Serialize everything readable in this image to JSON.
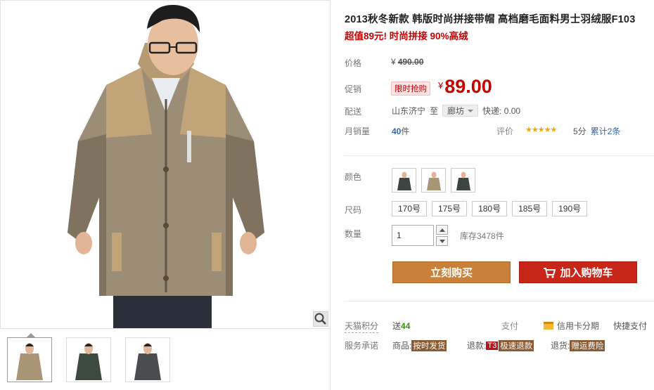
{
  "product": {
    "title": "2013秋冬新款 韩版时尚拼接带帽 高档磨毛面料男士羽绒服F103",
    "subtitle": "超值89元! 时尚拼接 90%高绒"
  },
  "price": {
    "label": "价格",
    "currency": "¥",
    "original": "490.00",
    "promo_label": "促销",
    "promo_badge": "限时抢购",
    "current": "89.00"
  },
  "shipping": {
    "label": "配送",
    "from": "山东济宁",
    "to_word": "至",
    "destination": "廊坊",
    "express": "快递: 0.00"
  },
  "sales": {
    "label": "月销量",
    "count": "40",
    "unit": "件",
    "rating_label": "评价",
    "stars": "★★★★★",
    "score": "5分",
    "cumulative": "累计2条"
  },
  "options": {
    "color_label": "颜色",
    "size_label": "尺码",
    "sizes": [
      "170号",
      "175号",
      "180号",
      "185号",
      "190号"
    ],
    "qty_label": "数量",
    "qty_value": "1",
    "stock": "库存3478件"
  },
  "actions": {
    "buy_now": "立刻购买",
    "add_cart": "加入购物车"
  },
  "services": {
    "points_label": "天猫积分",
    "points_prefix": "送",
    "points_value": "44",
    "pay_label": "支付",
    "credit_pay": "信用卡分期",
    "fast_pay": "快捷支付",
    "promise_label": "服务承诺",
    "goods_prefix": "商品:",
    "goods_tag": "按时发货",
    "refund_prefix": "退款:",
    "refund_t3": "T3",
    "refund_tag": "极速退款",
    "return_prefix": "退货:",
    "return_tag": "赠运费险"
  },
  "colors": {
    "price_red": "#c40000",
    "buy_button": "#c8803a",
    "cart_button": "#c82618",
    "star_yellow": "#f7a500"
  }
}
